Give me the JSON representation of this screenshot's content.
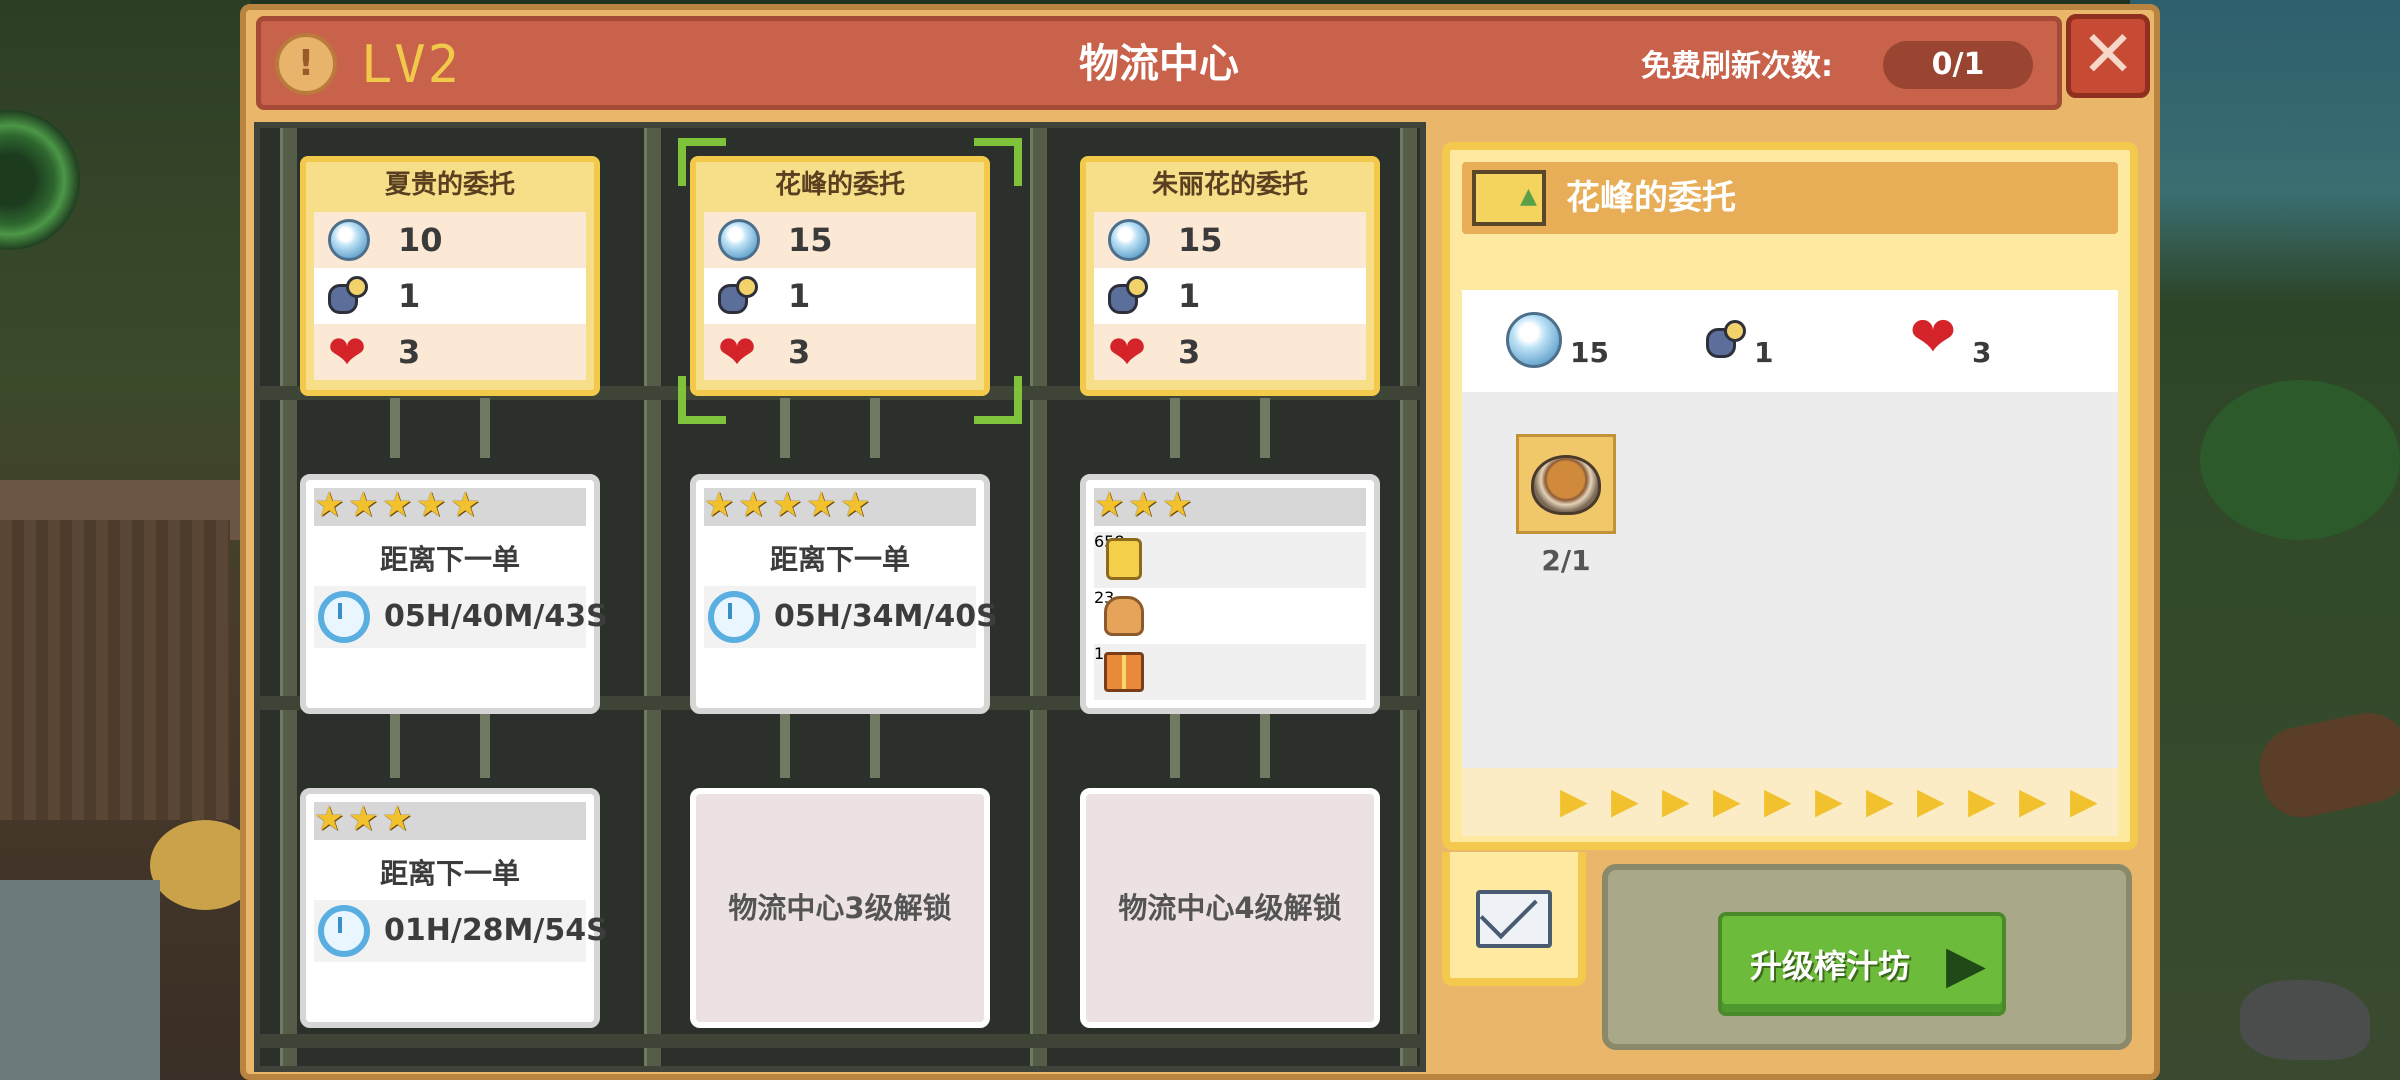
{
  "header": {
    "level": "LV2",
    "title": "物流中心",
    "refresh_label": "免费刷新次数:",
    "refresh_count": "0/1"
  },
  "orders": [
    {
      "name": "夏贵的委托",
      "diamond": "10",
      "workers": "1",
      "hearts": "3"
    },
    {
      "name": "花峰的委托",
      "diamond": "15",
      "workers": "1",
      "hearts": "3"
    },
    {
      "name": "朱丽花的委托",
      "diamond": "15",
      "workers": "1",
      "hearts": "3"
    }
  ],
  "slots_row2": [
    {
      "stars": 5,
      "label": "距离下一单",
      "timer": "05H/40M/43S"
    },
    {
      "stars": 5,
      "label": "距离下一单",
      "timer": "05H/34M/40S"
    },
    {
      "stars": 3,
      "coins": "658",
      "bread": "23",
      "chest": "1"
    }
  ],
  "slots_row3": [
    {
      "stars": 3,
      "label": "距离下一单",
      "timer": "01H/28M/54S"
    },
    {
      "lock_text": "物流中心3级解锁"
    },
    {
      "lock_text": "物流中心4级解锁"
    }
  ],
  "detail": {
    "title": "花峰的委托",
    "diamond": "15",
    "workers": "1",
    "hearts": "3",
    "item_count": "2/1"
  },
  "actions": {
    "upgrade_label": "升级榨汁坊"
  },
  "colors": {
    "panel": "#e9b66a",
    "titlebar": "#c8624a",
    "board": "#2c302a",
    "ticket": "#f6df88",
    "accent_green": "#6dbb3a",
    "selection": "#7ec33a"
  },
  "icons": [
    "diamond-icon",
    "worker-icon",
    "heart-icon",
    "clock-icon",
    "coin-icon",
    "bread-icon",
    "chest-icon",
    "star-icon",
    "mail-icon",
    "close-icon"
  ]
}
